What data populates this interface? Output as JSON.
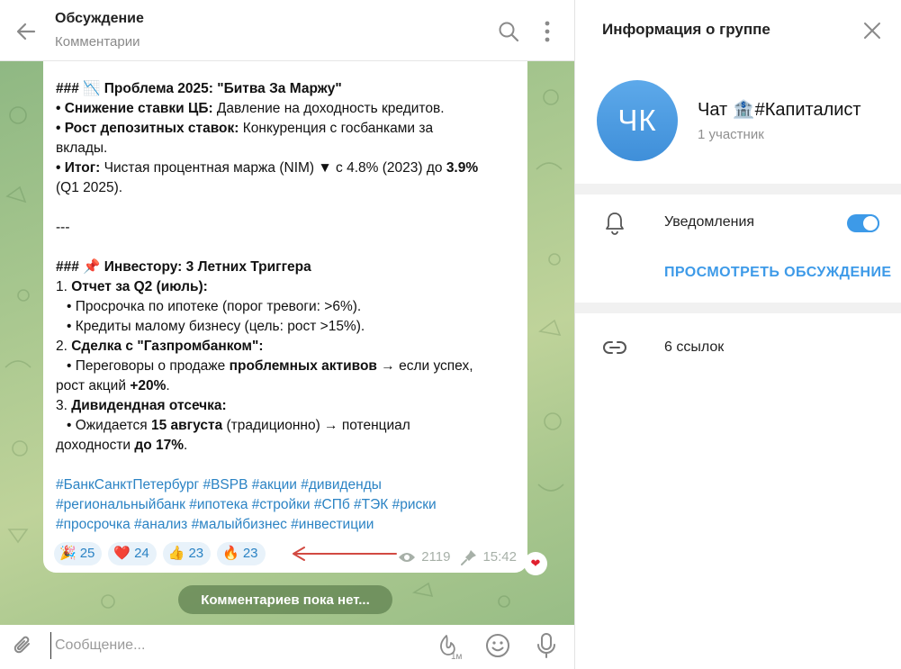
{
  "header": {
    "title": "Обсуждение",
    "subtitle": "Комментарии"
  },
  "post": {
    "lines": [
      {
        "text": "### 📉 Проблема 2025: \"Битва За Маржу\""
      },
      {
        "bold": "• Снижение ставки ЦБ:",
        "rest": " Давление на доходность кредитов."
      },
      {
        "bold": "• Рост депозитных ставок:",
        "rest": " Конкуренция с госбанками за"
      },
      {
        "text": "вклады."
      },
      {
        "bold": "• Итог:",
        "rest": " Чистая процентная маржа (NIM) ▼ с 4.8% (2023) до ",
        "bold2": "3.9%"
      },
      {
        "text": "(Q1 2025)."
      },
      {
        "text": "---"
      },
      {
        "text": "### 📌 Инвестору: 3 Летних Триггера"
      },
      {
        "pre": "1. ",
        "bold": "Отчет за Q2 (июль):"
      },
      {
        "text": "• Просрочка по ипотеке (порог тревоги: >6%)."
      },
      {
        "text": "• Кредиты малому бизнесу (цель: рост >15%)."
      },
      {
        "pre": "2. ",
        "bold": "Сделка с \"Газпромбанком\":"
      },
      {
        "rest": "• Переговоры о продаже ",
        "bold": "проблемных активов",
        "rest2": " → если успех,"
      },
      {
        "rest": "рост акций ",
        "bold": "+20%",
        "rest2": "."
      },
      {
        "pre": "3. ",
        "bold": "Дивидендная отсечка:"
      },
      {
        "rest": "• Ожидается ",
        "bold": "15 августа",
        "rest2": " (традиционно) → потенциал"
      },
      {
        "rest": "доходности ",
        "bold": "до 17%",
        "rest2": "."
      }
    ],
    "hashtags": [
      "#БанкСанктПетербург #BSPB #акции #дивиденды",
      "#региональныйбанк #ипотека #стройки #СПб #ТЭК #риски",
      "#просрочка #анализ #малыйбизнес #инвестиции"
    ],
    "reactions": [
      {
        "emoji": "🎉",
        "count": "25"
      },
      {
        "emoji": "❤️",
        "count": "24"
      },
      {
        "emoji": "👍",
        "count": "23"
      },
      {
        "emoji": "🔥",
        "count": "23"
      }
    ],
    "views": "2119",
    "time": "15:42",
    "badge": "❤"
  },
  "no_comments": "Комментариев пока нет...",
  "composer": {
    "placeholder": "Сообщение...",
    "timer_label": "1м"
  },
  "info": {
    "title": "Информация о группе",
    "avatar_initials": "ЧК",
    "group_name": "Чат 🏦#Капиталист",
    "members": "1 участник",
    "notifications_label": "Уведомления",
    "view_discussion": "ПРОСМОТРЕТЬ ОБСУЖДЕНИЕ",
    "links_label": "6 ссылок"
  },
  "colors": {
    "accent": "#3d9ae8",
    "hashtag": "#2b83c4",
    "reaction_bg": "#e8f2fa",
    "arrow": "#d24a42"
  }
}
